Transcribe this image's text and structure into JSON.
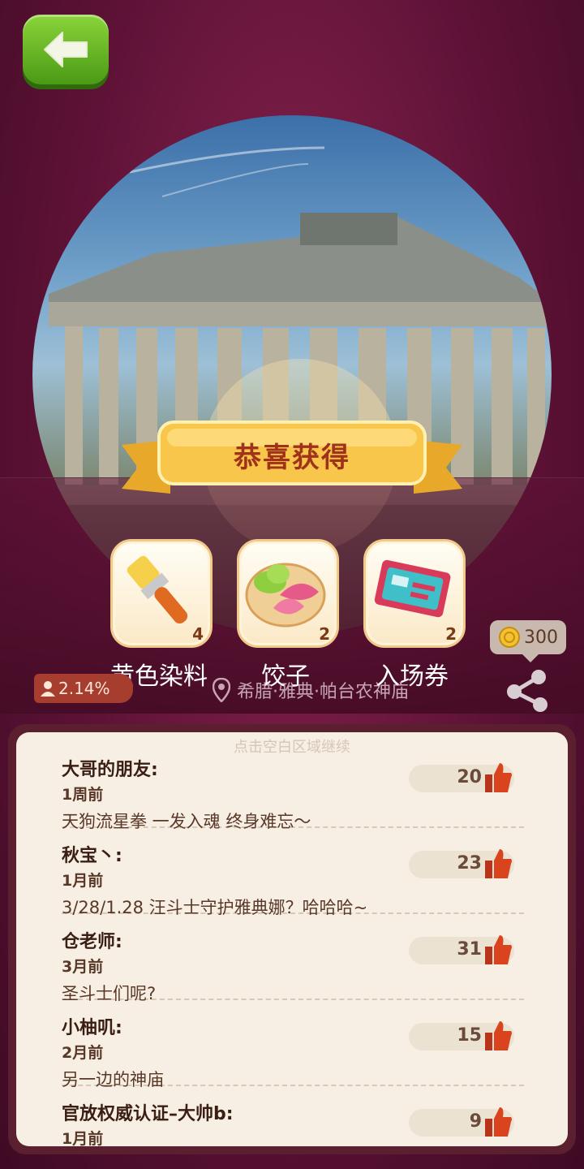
{
  "header": {
    "back_icon": "arrow-left-icon"
  },
  "banner": {
    "title": "恭喜获得"
  },
  "rewards": [
    {
      "name": "黄色染料",
      "count": "4",
      "icon": "paintbrush-icon"
    },
    {
      "name": "饺子",
      "count": "2",
      "icon": "dumplings-icon"
    },
    {
      "name": "入场券",
      "count": "2",
      "icon": "ticket-icon"
    }
  ],
  "stats": {
    "percent": "2.14%",
    "location": "希腊·雅典·帕台农神庙",
    "coins": "300"
  },
  "comments_panel": {
    "hint": "点击空白区域继续",
    "comments": [
      {
        "name": "大哥的朋友:",
        "time": "1周前",
        "text": "天狗流星拳 一发入魂 终身难忘～",
        "likes": "20"
      },
      {
        "name": "秋宝丶:",
        "time": "1月前",
        "text": "3/28/1.28 汪斗士守护雅典娜？哈哈哈~",
        "likes": "23"
      },
      {
        "name": "仓老师:",
        "time": "3月前",
        "text": "圣斗士们呢?",
        "likes": "31"
      },
      {
        "name": "小柚叽:",
        "time": "2月前",
        "text": "另一边的神庙",
        "likes": "15"
      },
      {
        "name": "官放权威认证–大帅b:",
        "time": "1月前",
        "text": "",
        "likes": "9"
      }
    ]
  },
  "colors": {
    "background": "#5e1236",
    "back_button": "#6cbb25",
    "ribbon": "#f7c64a",
    "panel": "#f7efe3"
  }
}
